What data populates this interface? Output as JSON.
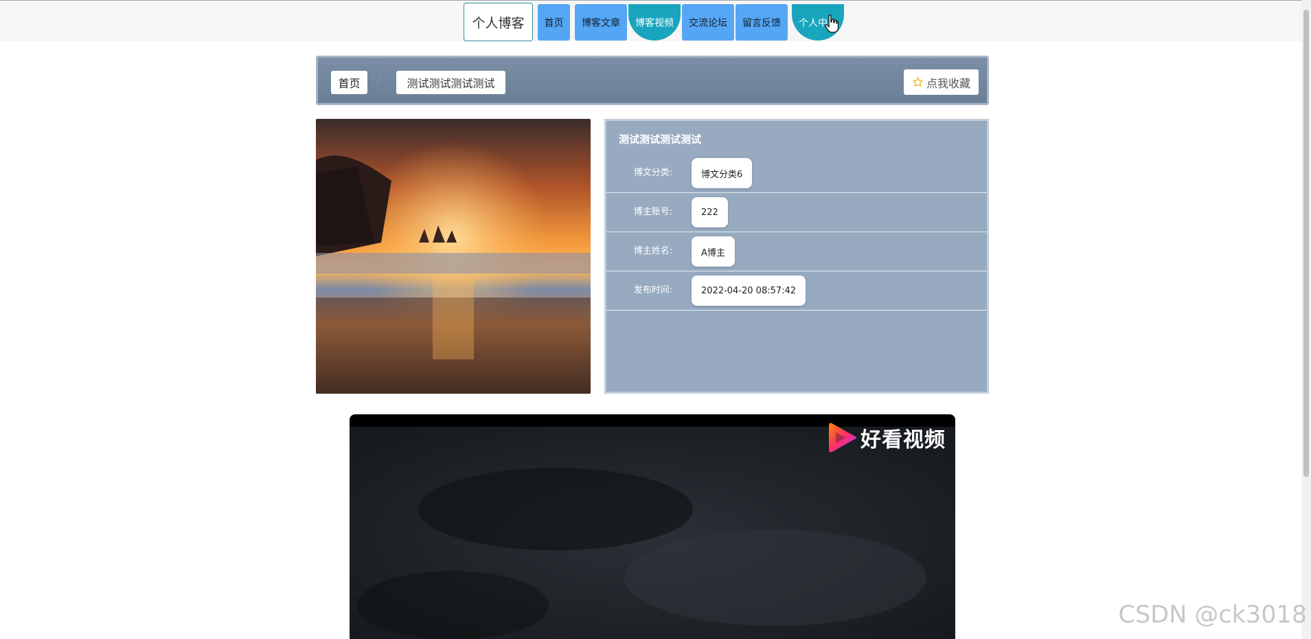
{
  "nav": {
    "brand": "个人博客",
    "items": [
      {
        "label": "首页"
      },
      {
        "label": "博客文章"
      },
      {
        "label": "博客视频"
      },
      {
        "label": "交流论坛"
      },
      {
        "label": "留言反馈"
      },
      {
        "label": "个人中心"
      }
    ]
  },
  "breadcrumb": {
    "home": "首页",
    "separator": "/",
    "title": "测试测试测试测试"
  },
  "favorite_button": {
    "label": "点我收藏",
    "icon": "star-icon"
  },
  "detail": {
    "title": "测试测试测试测试",
    "rows": [
      {
        "label": "博文分类:",
        "value": "博文分类6"
      },
      {
        "label": "博主账号:",
        "value": "222"
      },
      {
        "label": "博主姓名:",
        "value": "A博主"
      },
      {
        "label": "发布时间:",
        "value": "2022-04-20 08:57:42"
      }
    ]
  },
  "video": {
    "logo_text": "好看视频"
  },
  "watermark": "CSDN @ck3018",
  "colors": {
    "nav_square": "#55a6f4",
    "nav_round": "#1aa5bf",
    "panel": "#97aac0",
    "crumb_bar": "#7388a0"
  }
}
